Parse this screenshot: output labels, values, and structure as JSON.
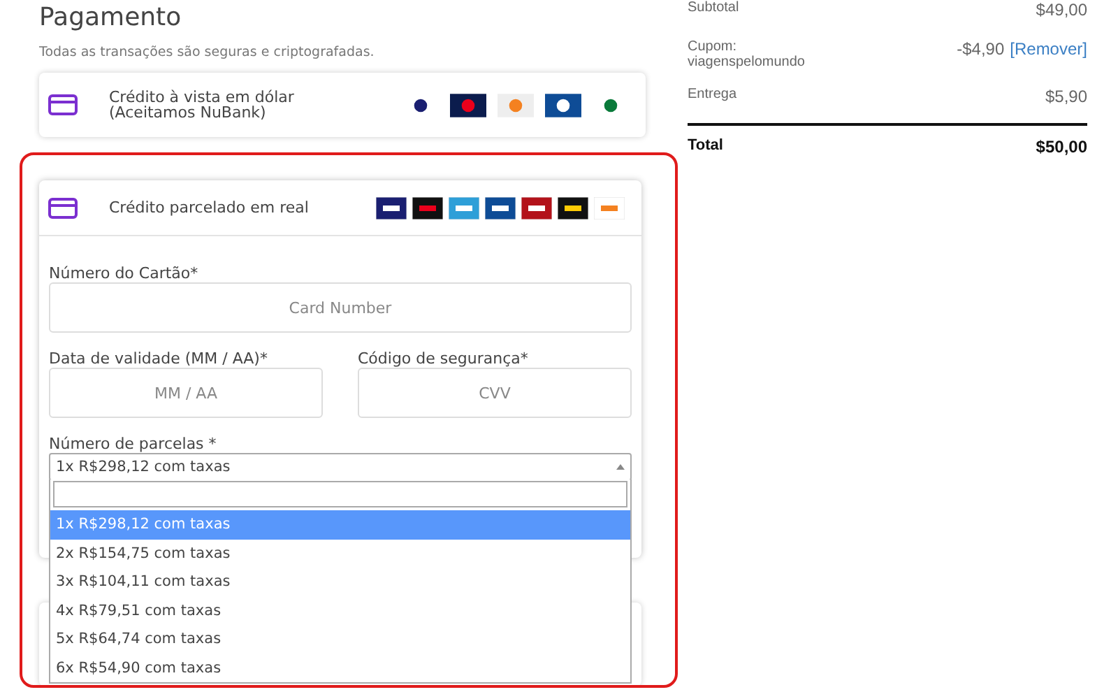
{
  "payment": {
    "title": "Pagamento",
    "subtitle": "Todas as transações são seguras e criptografadas.",
    "methods": [
      {
        "label": "Crédito à vista em dólar\n(Aceitamos NuBank)",
        "selected": false
      },
      {
        "label": "Crédito parcelado em real",
        "selected": true
      }
    ],
    "form": {
      "card_number": {
        "label": "Número do Cartão*",
        "placeholder": "Card Number"
      },
      "expiry": {
        "label": "Data de validade (MM / AA)*",
        "placeholder": "MM / AA"
      },
      "cvv": {
        "label": "Código de segurança*",
        "placeholder": "CVV"
      },
      "installments": {
        "label": "Número de parcelas *",
        "value": "1x R$298,12 com taxas",
        "expanded": true,
        "options": [
          {
            "label": "1x R$298,12 com taxas",
            "selected": true
          },
          {
            "label": "2x R$154,75 com taxas",
            "selected": false
          },
          {
            "label": "3x R$104,11 com taxas",
            "selected": false
          },
          {
            "label": "4x R$79,51 com taxas",
            "selected": false
          },
          {
            "label": "5x R$64,74 com taxas",
            "selected": false
          },
          {
            "label": "6x R$54,90 com taxas",
            "selected": false
          }
        ]
      }
    }
  },
  "summary": {
    "rows": [
      {
        "label": "Subtotal",
        "value": "$49,00"
      },
      {
        "label": "Cupom:\nviagenspelomundo",
        "value": "-$4,90",
        "link": "[Remover]"
      },
      {
        "label": "Entrega",
        "value": "$5,90"
      }
    ],
    "total": {
      "label": "Total",
      "value": "$50,00"
    }
  }
}
